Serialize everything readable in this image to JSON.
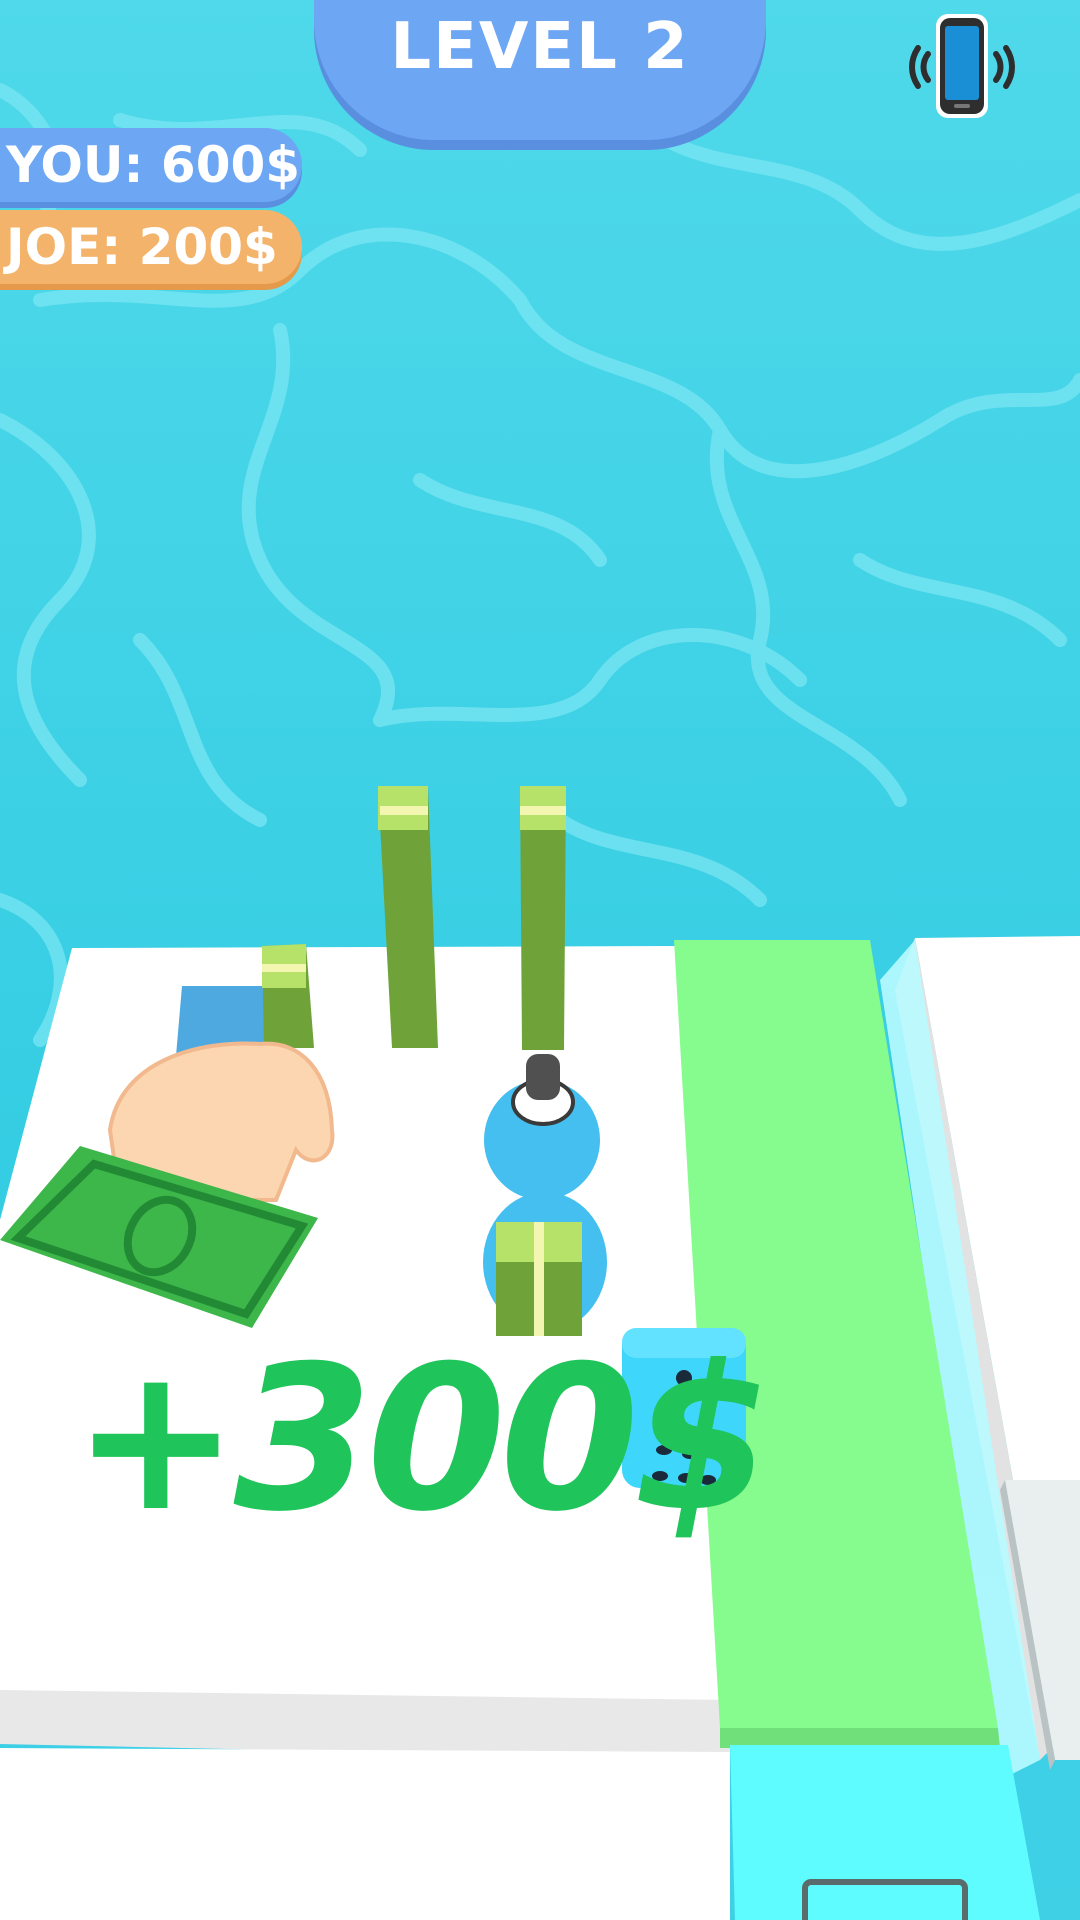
{
  "hud": {
    "level_label": "LEVEL 2",
    "you_score": "YOU: 600$",
    "joe_score": "JOE:  200$",
    "vibration_icon": "vibration-phone-icon"
  },
  "scene": {
    "gain_text": "+300$",
    "colors": {
      "water": "#3fd3e6",
      "platform": "#ffffff",
      "lane": "#86fb8e",
      "player": "#45bff0",
      "cash": "#6fa33a",
      "gain_text": "#1fc45a"
    }
  }
}
